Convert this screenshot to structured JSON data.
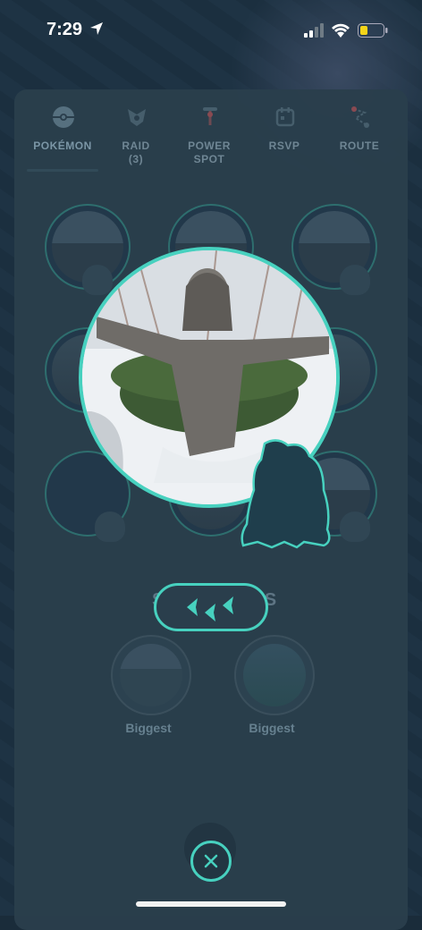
{
  "status_bar": {
    "time": "7:29"
  },
  "tabs": [
    {
      "label": "POKÉMON",
      "icon": "pokeball-icon",
      "active": true
    },
    {
      "label": "RAID\n(3)",
      "icon": "raid-icon",
      "active": false
    },
    {
      "label": "POWER\nSPOT",
      "icon": "power-spot-icon",
      "active": false
    },
    {
      "label": "RSVP",
      "icon": "calendar-icon",
      "active": false
    },
    {
      "label": "ROUTE",
      "icon": "route-icon",
      "active": false
    }
  ],
  "showcases": {
    "title": "SHOWCASES",
    "items": [
      {
        "label": "Biggest"
      },
      {
        "label": "Biggest"
      }
    ]
  },
  "colors": {
    "accent": "#47d1bf",
    "panel": "#2a3e4c"
  }
}
